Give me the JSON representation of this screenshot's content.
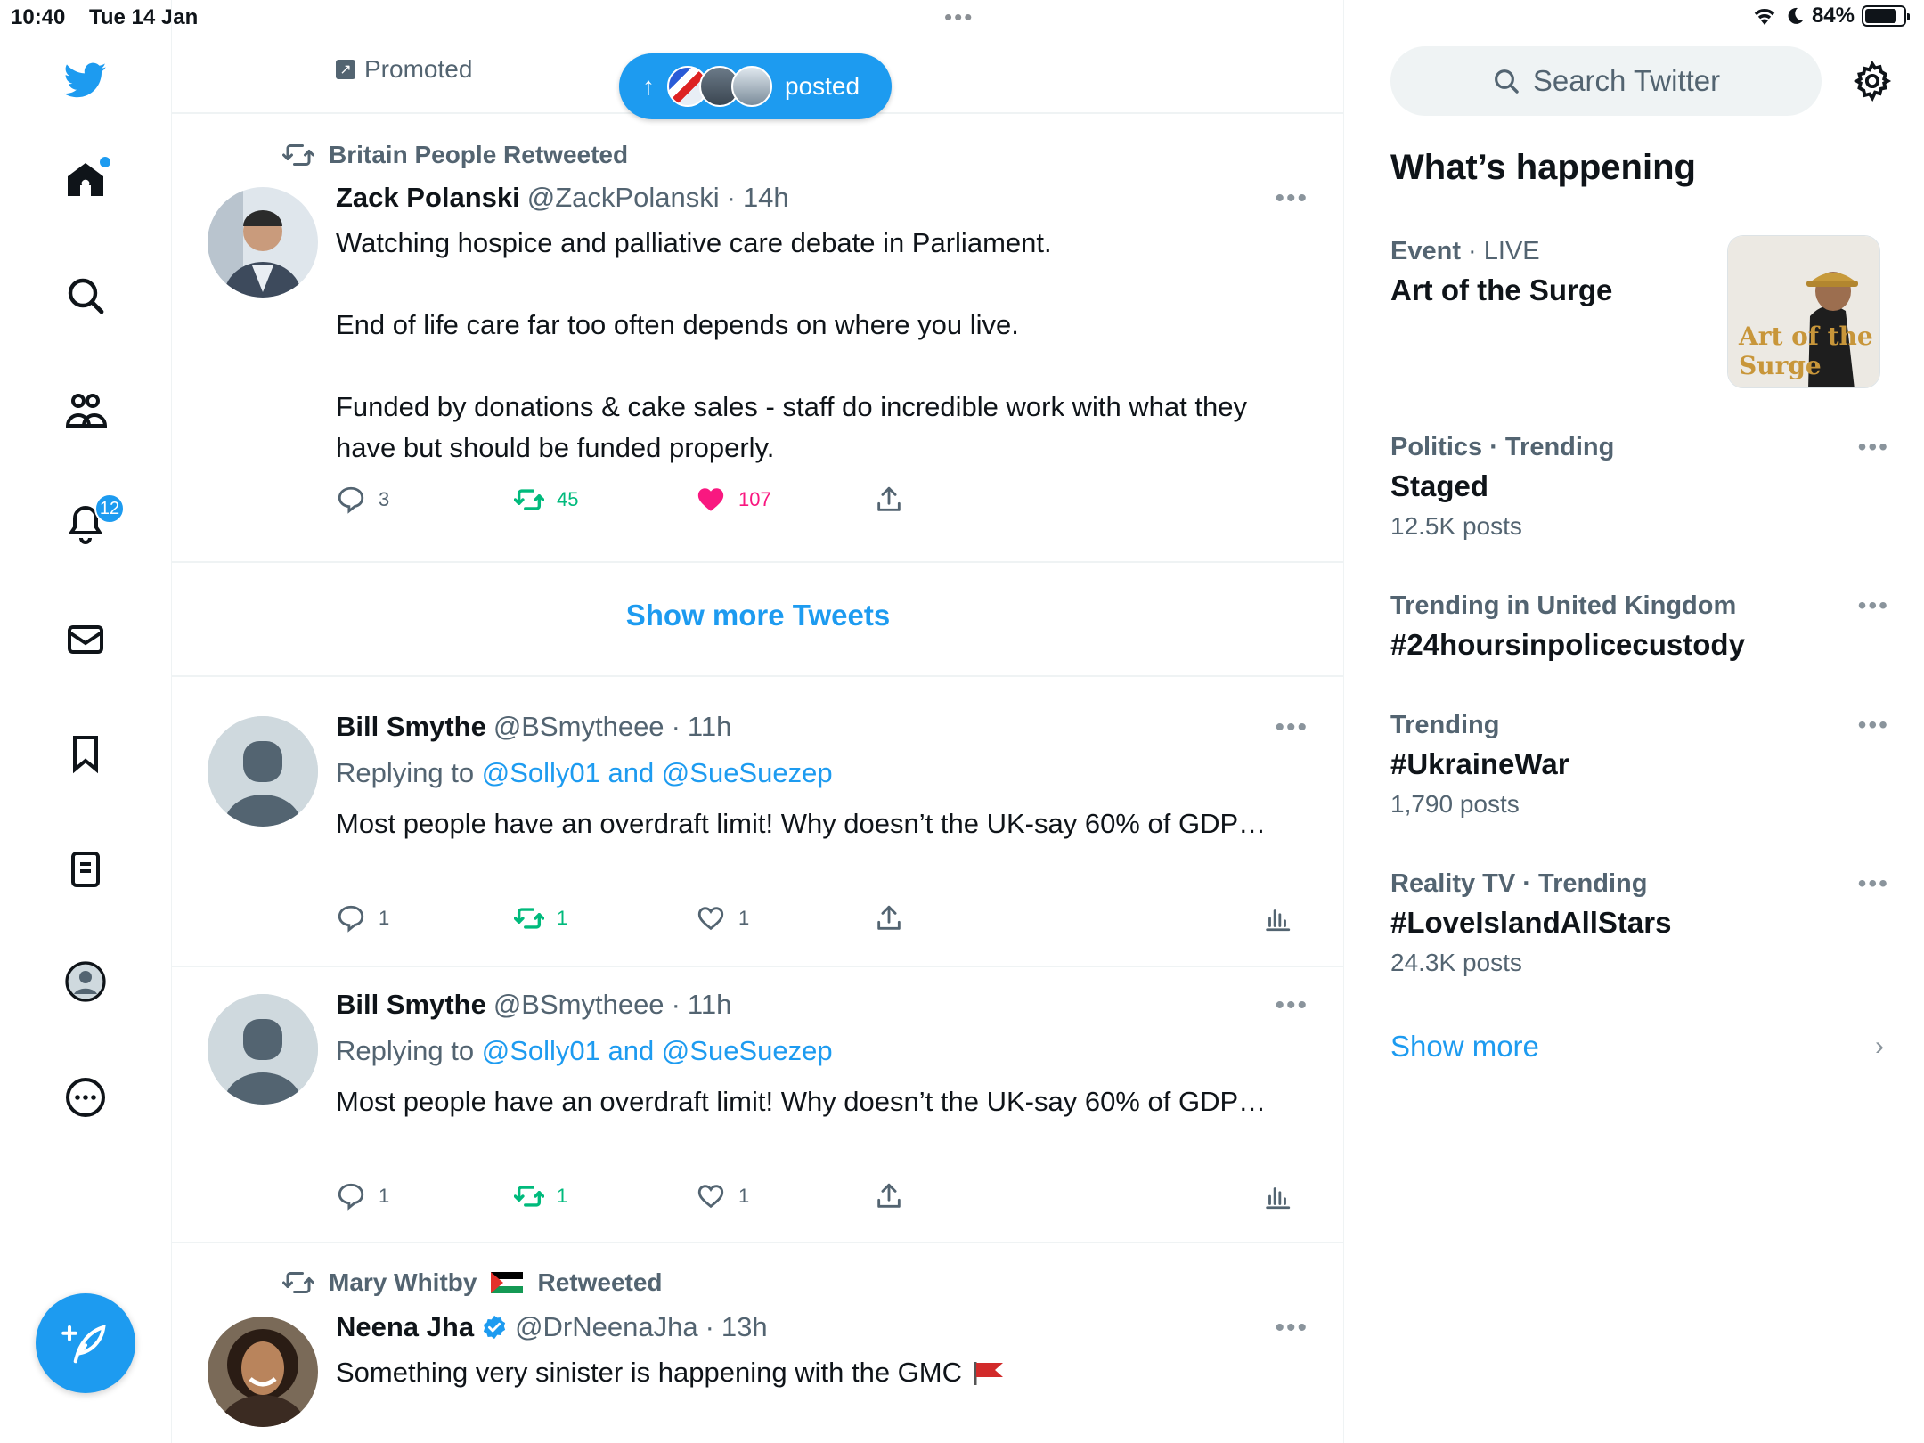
{
  "status_bar": {
    "time": "10:40",
    "date": "Tue 14 Jan",
    "battery": "84%",
    "battery_level": 0.84
  },
  "nav": {
    "notifications_count": "12",
    "items": [
      "home",
      "search",
      "communities",
      "notifications",
      "messages",
      "bookmarks",
      "lists",
      "profile",
      "more"
    ]
  },
  "banner": {
    "promoted": "Promoted",
    "posted_pill": "posted"
  },
  "tweets": [
    {
      "retweeted_by": "Britain People Retweeted",
      "name": "Zack Polanski",
      "handle": "@ZackPolanski",
      "time": "14h",
      "body": "Watching hospice and palliative care debate in Parliament.\n\nEnd of life care far too often depends on where you live.\n\nFunded by donations & cake sales - staff do incredible work with what they have but should be funded properly.",
      "replies": "3",
      "retweets": "45",
      "likes": "107"
    },
    {
      "name": "Bill Smythe",
      "handle": "@BSmytheee",
      "time": "11h",
      "replying_prefix": "Replying to ",
      "replying_to": "@Solly01 and @SueSuezep",
      "body": "Most people have an overdraft limit! Why doesn’t the UK-say 60% of GDP…",
      "replies": "1",
      "retweets": "1",
      "likes": "1"
    },
    {
      "name": "Bill Smythe",
      "handle": "@BSmytheee",
      "time": "11h",
      "replying_prefix": "Replying to ",
      "replying_to": "@Solly01 and @SueSuezep",
      "body": "Most people have an overdraft limit! Why doesn’t the UK-say 60% of GDP…",
      "replies": "1",
      "retweets": "1",
      "likes": "1"
    },
    {
      "retweeted_by_name": "Mary Whitby",
      "retweeted_suffix": "Retweeted",
      "name": "Neena Jha",
      "handle": "@DrNeenaJha",
      "time": "13h",
      "body": "Something very sinister is happening with the GMC"
    }
  ],
  "show_more_tweets": "Show more Tweets",
  "sidebar": {
    "search_placeholder": "Search Twitter",
    "title": "What’s happening",
    "trends": [
      {
        "category_strong": "Event",
        "category_rest": " · LIVE",
        "name": "Art of the Surge"
      },
      {
        "category": "Politics · Trending",
        "name": "Staged",
        "count": "12.5K posts"
      },
      {
        "category": "Trending in United Kingdom",
        "name": "#24hoursinpolicecustody"
      },
      {
        "category": "Trending",
        "name": "#UkraineWar",
        "count": "1,790 posts"
      },
      {
        "category": "Reality TV · Trending",
        "name": "#LoveIslandAllStars",
        "count": "24.3K posts"
      }
    ],
    "event_thumb_text": "Art of the Surge",
    "show_more": "Show more"
  },
  "colors": {
    "accent": "#1d9bf0",
    "retweet_green": "#00ba7c",
    "like_pink": "#f91880",
    "secondary_text": "#536471"
  }
}
